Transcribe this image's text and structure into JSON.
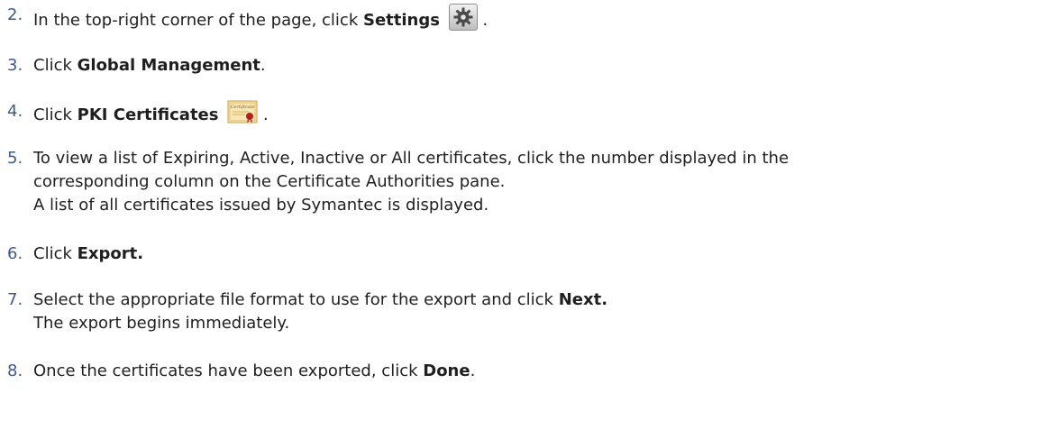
{
  "steps": [
    {
      "num": "2.",
      "pre": "In the top-right corner of the page, click ",
      "bold": "Settings",
      "post": " ."
    },
    {
      "num": "3.",
      "pre": "Click ",
      "bold": "Global Management",
      "post": "."
    },
    {
      "num": "4.",
      "pre": "Click ",
      "bold": "PKI Certificates",
      "post": " ."
    },
    {
      "num": "5.",
      "line1": "To view a list of Expiring, Active, Inactive or All certificates, click the number displayed in the",
      "line2": "corresponding column on the Certificate Authorities pane.",
      "line3": "A list of all certificates issued by Symantec is displayed."
    },
    {
      "num": "6.",
      "pre": "Click ",
      "bold": "Export."
    },
    {
      "num": "7.",
      "pre": "Select the appropriate file format to use for the export and click ",
      "bold": "Next.",
      "line2": "The export begins immediately."
    },
    {
      "num": "8.",
      "pre": "Once the certificates have been exported, click ",
      "bold": "Done",
      "post": "."
    }
  ],
  "icons": {
    "settings": "gear-icon",
    "certificate": "certificate-icon",
    "certificate_label": "Certificate"
  }
}
